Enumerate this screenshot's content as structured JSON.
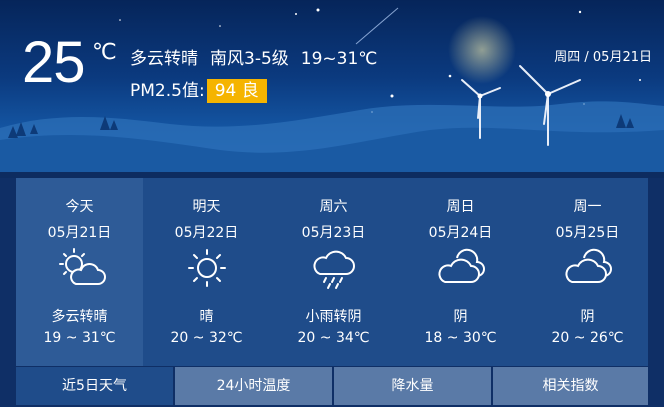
{
  "current": {
    "temp": "25",
    "unit": "℃",
    "condition": "多云转晴",
    "wind": "南风3-5级",
    "range": "19~31℃",
    "pm_label": "PM2.5值:",
    "pm_badge": "94 良",
    "date": "周四 / 05月21日"
  },
  "forecast": [
    {
      "weekday": "今天",
      "date": "05月21日",
      "icon": "partly-cloudy-icon",
      "desc": "多云转晴",
      "range": "19 ~ 31℃"
    },
    {
      "weekday": "明天",
      "date": "05月22日",
      "icon": "sun-icon",
      "desc": "晴",
      "range": "20 ~ 32℃"
    },
    {
      "weekday": "周六",
      "date": "05月23日",
      "icon": "rain-cloud-icon",
      "desc": "小雨转阴",
      "range": "20 ~ 34℃"
    },
    {
      "weekday": "周日",
      "date": "05月24日",
      "icon": "cloud-icon",
      "desc": "阴",
      "range": "18 ~ 30℃"
    },
    {
      "weekday": "周一",
      "date": "05月25日",
      "icon": "cloud-icon",
      "desc": "阴",
      "range": "20 ~ 26℃"
    }
  ],
  "tabs": [
    "近5日天气",
    "24小时温度",
    "降水量",
    "相关指数"
  ],
  "colors": {
    "pm_badge": "#f5b400",
    "panel": "#1f4c8a",
    "tab": "#5a7aa7"
  }
}
